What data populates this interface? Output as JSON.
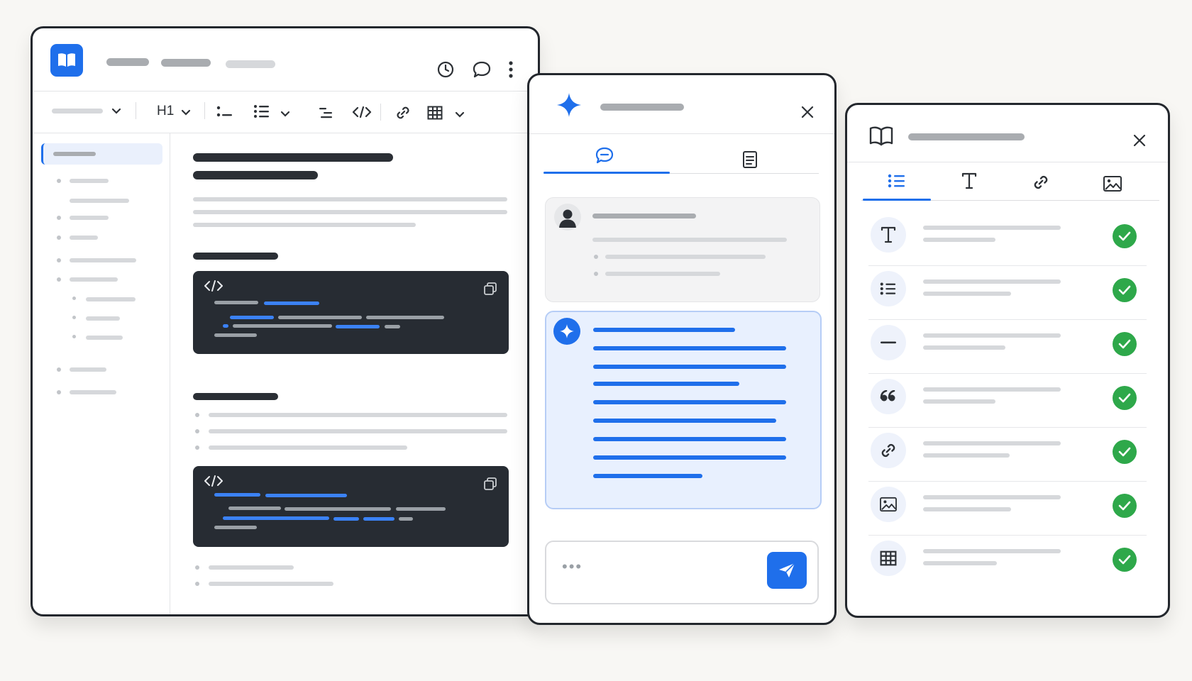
{
  "colors": {
    "accent": "#1f6feb",
    "frame": "#23272d",
    "code_bg": "#272c33",
    "success": "#2ea84a",
    "ai_bubble_bg": "#e8f0fe"
  },
  "editor": {
    "toolbar": {
      "heading_label": "H1"
    },
    "icons": [
      "book-icon",
      "history-icon",
      "comment-icon",
      "more-icon",
      "bullet-list-icon",
      "numbered-list-icon",
      "indent-icon",
      "code-icon",
      "link-icon",
      "table-icon",
      "copy-icon"
    ]
  },
  "assistant": {
    "input": {
      "placeholder": "•••"
    },
    "icons": [
      "sparkle-icon",
      "close-icon",
      "chat-icon",
      "document-icon",
      "user-icon",
      "send-icon"
    ]
  },
  "blocks_panel": {
    "icons": [
      "book-open-icon",
      "close-icon",
      "list-icon",
      "text-icon",
      "link-icon",
      "image-icon"
    ],
    "block_types": [
      {
        "icon": "text-icon",
        "status": "done"
      },
      {
        "icon": "list-icon",
        "status": "done"
      },
      {
        "icon": "divider-icon",
        "status": "done"
      },
      {
        "icon": "quote-icon",
        "status": "done"
      },
      {
        "icon": "link-icon",
        "status": "done"
      },
      {
        "icon": "image-icon",
        "status": "done"
      },
      {
        "icon": "table-icon",
        "status": "done"
      }
    ]
  }
}
